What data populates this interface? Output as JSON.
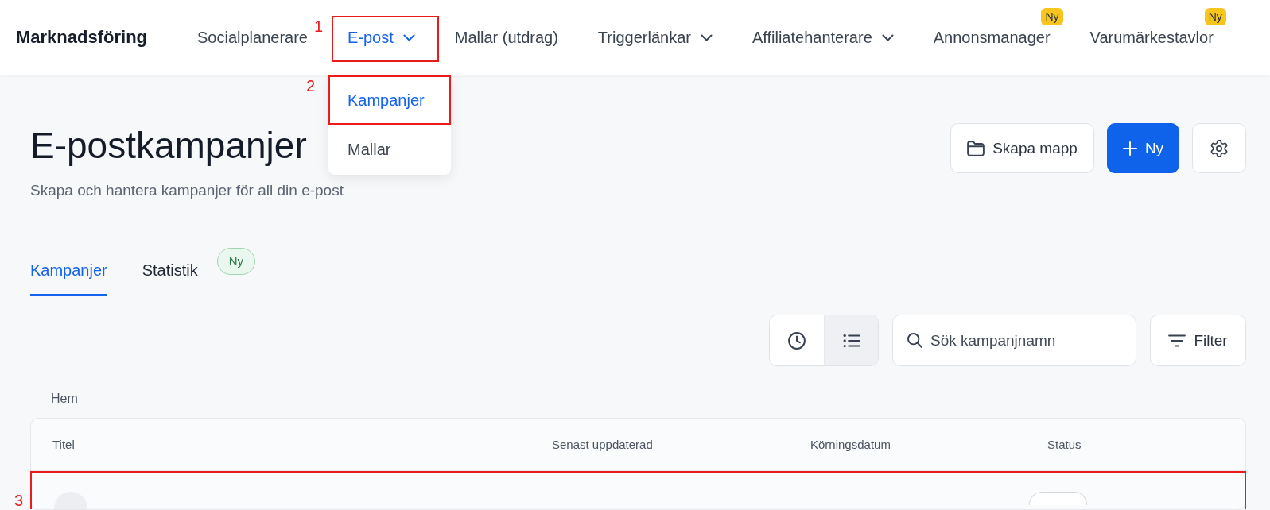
{
  "nav": {
    "brand": "Marknadsföring",
    "items": [
      {
        "label": "Socialplanerare",
        "selected": false,
        "has_menu": false
      },
      {
        "label": "E-post",
        "selected": true,
        "has_menu": true,
        "annotation": "1",
        "menu": [
          {
            "label": "Kampanjer",
            "selected": true,
            "annotation": "2"
          },
          {
            "label": "Mallar",
            "selected": false
          }
        ]
      },
      {
        "label": "Mallar (utdrag)",
        "selected": false,
        "has_menu": false
      },
      {
        "label": "Triggerlänkar",
        "selected": false,
        "has_menu": true
      },
      {
        "label": "Affiliatehanterare",
        "selected": false,
        "has_menu": true
      },
      {
        "label": "Annonsmanager",
        "selected": false,
        "has_menu": false,
        "badge": "Ny"
      },
      {
        "label": "Varumärkestavlor",
        "selected": false,
        "has_menu": false,
        "badge": "Ny"
      }
    ]
  },
  "header": {
    "title": "E-postkampanjer",
    "subtitle": "Skapa och hantera kampanjer för all din e-post",
    "buttons": [
      {
        "kind": "folder",
        "label": "Skapa mapp"
      },
      {
        "kind": "new",
        "label": "Ny"
      },
      {
        "kind": "settings"
      }
    ]
  },
  "tabs": [
    {
      "label": "Kampanjer",
      "selected": true
    },
    {
      "label": "Statistik",
      "selected": false,
      "badge": "Ny"
    }
  ],
  "toolbar": {
    "view_toggle": [
      {
        "kind": "history",
        "selected": false
      },
      {
        "kind": "list",
        "selected": true
      }
    ],
    "search": {
      "placeholder": "Sök kampanjnamn"
    },
    "filter": {
      "label": "Filter"
    }
  },
  "breadcrumb": "Hem",
  "table": {
    "columns": [
      "Titel",
      "Senast uppdaterad",
      "Körningsdatum",
      "Status"
    ],
    "rows": [
      {
        "annotation": "3"
      }
    ]
  }
}
